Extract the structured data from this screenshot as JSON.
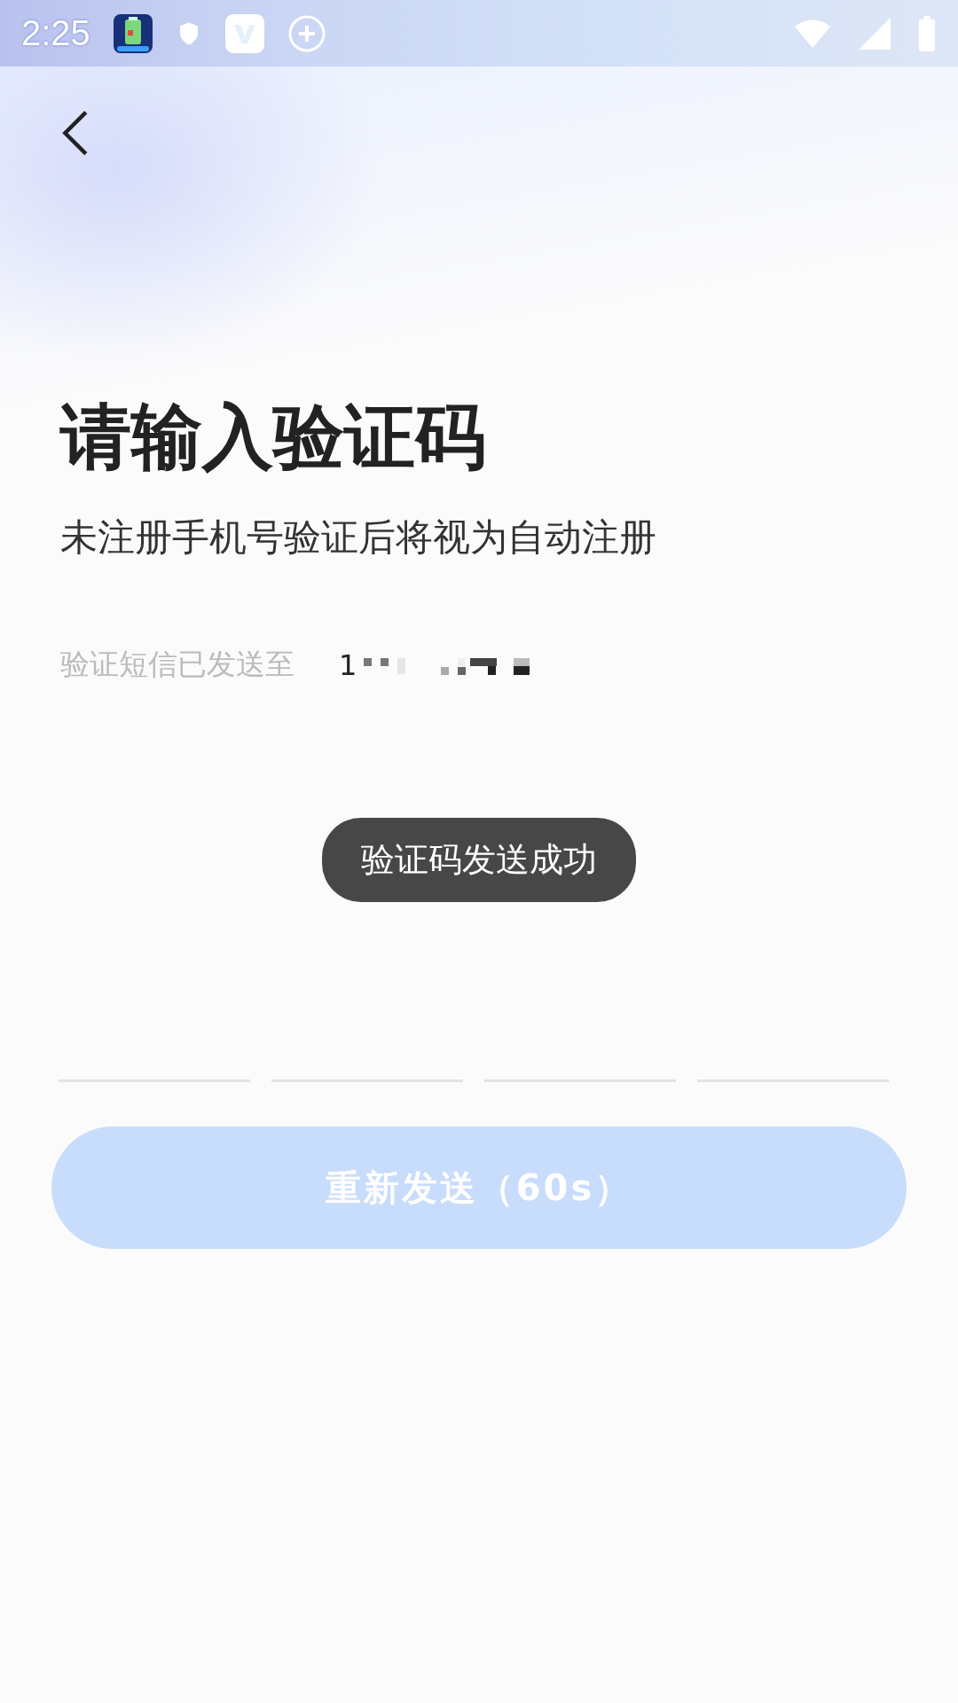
{
  "status_bar": {
    "time": "2:25"
  },
  "title": "请输入验证码",
  "subtitle": "未注册手机号验证后将视为自动注册",
  "sent_to": {
    "label": "验证短信已发送至",
    "phone": "1"
  },
  "toast": "验证码发送成功",
  "code_fields": [
    {
      "kind": "digit"
    },
    {
      "kind": "digit"
    },
    {
      "kind": "digit"
    },
    {
      "kind": "digit"
    }
  ],
  "resend_button": {
    "label": "重新发送（60s）",
    "disabled": true
  }
}
